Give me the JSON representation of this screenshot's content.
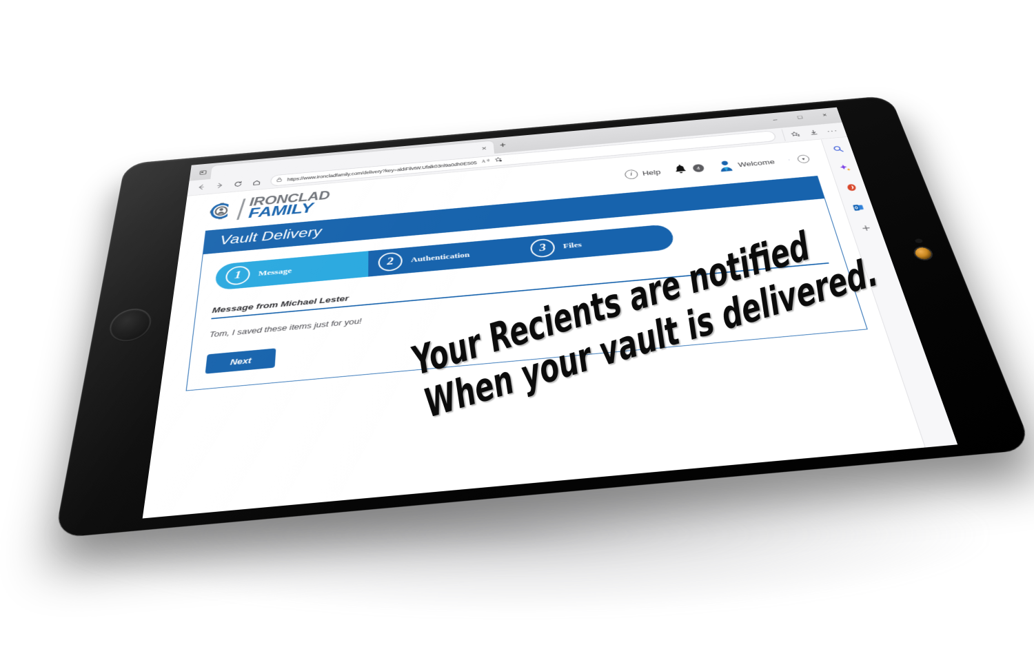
{
  "browser": {
    "tab_close_label": "×",
    "new_tab_label": "+",
    "window_minimize": "–",
    "window_maximize": "□",
    "window_close": "×",
    "url": "https://www.ironcladfamily.com/delivery?key=aldiFilvtW.Ufalk03nl9a0dh0ES05",
    "nav": {
      "back": "←",
      "forward": "→",
      "refresh": "⟳",
      "home": "⌂"
    },
    "toolbar": {
      "read_aloud": "A",
      "add_favorite": "☆",
      "favorites": "☆",
      "downloads": "⤓",
      "settings_more": "···"
    },
    "sidebar": {
      "expand": "›",
      "items": [
        {
          "name": "search-icon",
          "glyph": "⌕",
          "color": "#3a5bd9"
        },
        {
          "name": "copilot-icon",
          "glyph": "✦",
          "color": "#7b3fe4"
        },
        {
          "name": "office-icon",
          "glyph": "◕",
          "color": "#d8472b"
        },
        {
          "name": "outlook-icon",
          "glyph": "✉",
          "color": "#1a73c8"
        },
        {
          "name": "add-tool-icon",
          "glyph": "+",
          "color": "#5a5a5e"
        }
      ]
    }
  },
  "site": {
    "logo": {
      "line1": "IRONCLAD",
      "line2": "FAMILY",
      "line1_color": "#6e7278",
      "line2_color": "#1763ad"
    },
    "header": {
      "help_label": "Help",
      "help_icon": "i",
      "notifications_count": "4",
      "welcome_label": "Welcome",
      "dropdown_icon": "▾",
      "tiny_mark": "·"
    }
  },
  "vault": {
    "banner_title": "Vault Delivery",
    "steps": [
      {
        "number": "1",
        "label": "Message",
        "state": "active"
      },
      {
        "number": "2",
        "label": "Authentication",
        "state": "inactive"
      },
      {
        "number": "3",
        "label": "Files",
        "state": "inactive"
      }
    ],
    "message_title": "Message from Michael Lester",
    "message_body": "Tom, I saved these items just for you!",
    "next_button": "Next"
  },
  "overlay": {
    "line1": "Your Recients are notified",
    "line2": "When your vault is delivered."
  },
  "colors": {
    "brand_blue": "#1763ad",
    "accent_cyan": "#2aa9e0",
    "logo_gray": "#6e7278"
  }
}
